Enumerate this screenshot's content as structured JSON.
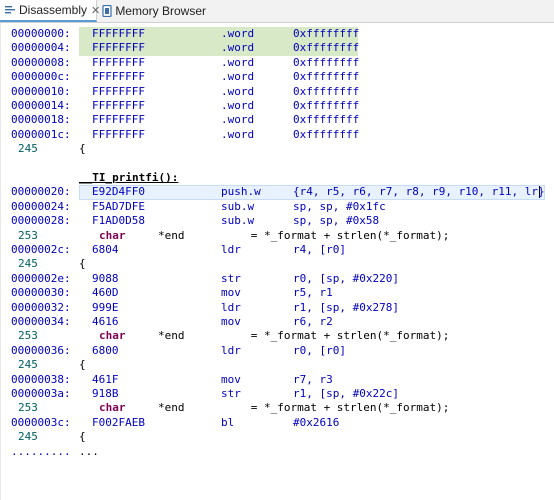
{
  "tabs": [
    {
      "label": "Disassembly",
      "icon": "disassembly-icon"
    },
    {
      "label": "Memory Browser",
      "icon": "memory-browser-icon"
    }
  ],
  "lines": [
    {
      "kind": "asm",
      "addr": "00000000:",
      "op": "FFFFFFFF",
      "mn": ".word",
      "args": "0xffffffff",
      "hl": "green"
    },
    {
      "kind": "asm",
      "addr": "00000004:",
      "op": "FFFFFFFF",
      "mn": ".word",
      "args": "0xffffffff",
      "hl": "green"
    },
    {
      "kind": "asm",
      "addr": "00000008:",
      "op": "FFFFFFFF",
      "mn": ".word",
      "args": "0xffffffff"
    },
    {
      "kind": "asm",
      "addr": "0000000c:",
      "op": "FFFFFFFF",
      "mn": ".word",
      "args": "0xffffffff"
    },
    {
      "kind": "asm",
      "addr": "00000010:",
      "op": "FFFFFFFF",
      "mn": ".word",
      "args": "0xffffffff"
    },
    {
      "kind": "asm",
      "addr": "00000014:",
      "op": "FFFFFFFF",
      "mn": ".word",
      "args": "0xffffffff"
    },
    {
      "kind": "asm",
      "addr": "00000018:",
      "op": "FFFFFFFF",
      "mn": ".word",
      "args": "0xffffffff"
    },
    {
      "kind": "asm",
      "addr": "0000001c:",
      "op": "FFFFFFFF",
      "mn": ".word",
      "args": "0xffffffff"
    },
    {
      "kind": "src",
      "lineno": "245",
      "text": "{"
    },
    {
      "kind": "blank"
    },
    {
      "kind": "func",
      "text": "__TI_printfi():"
    },
    {
      "kind": "asm",
      "addr": "00000020:",
      "op": "E92D4FF0",
      "mn": "push.w",
      "args": "{r4, r5, r6, r7, r8, r9, r10, r11, lr}",
      "hl": "blue"
    },
    {
      "kind": "asm",
      "addr": "00000024:",
      "op": "F5AD7DFE",
      "mn": "sub.w",
      "args": "sp, sp, #0x1fc"
    },
    {
      "kind": "asm",
      "addr": "00000028:",
      "op": "F1AD0D58",
      "mn": "sub.w",
      "args": "sp, sp, #0x58"
    },
    {
      "kind": "src",
      "lineno": "253",
      "kw": "char",
      "text": "*end          = *_format + strlen(*_format);"
    },
    {
      "kind": "asm",
      "addr": "0000002c:",
      "op": "6804",
      "mn": "ldr",
      "args": "r4, [r0]"
    },
    {
      "kind": "src",
      "lineno": "245",
      "text": "{"
    },
    {
      "kind": "asm",
      "addr": "0000002e:",
      "op": "9088",
      "mn": "str",
      "args": "r0, [sp, #0x220]"
    },
    {
      "kind": "asm",
      "addr": "00000030:",
      "op": "460D",
      "mn": "mov",
      "args": "r5, r1"
    },
    {
      "kind": "asm",
      "addr": "00000032:",
      "op": "999E",
      "mn": "ldr",
      "args": "r1, [sp, #0x278]"
    },
    {
      "kind": "asm",
      "addr": "00000034:",
      "op": "4616",
      "mn": "mov",
      "args": "r6, r2"
    },
    {
      "kind": "src",
      "lineno": "253",
      "kw": "char",
      "text": "*end          = *_format + strlen(*_format);"
    },
    {
      "kind": "asm",
      "addr": "00000036:",
      "op": "6800",
      "mn": "ldr",
      "args": "r0, [r0]"
    },
    {
      "kind": "src",
      "lineno": "245",
      "text": "{"
    },
    {
      "kind": "asm",
      "addr": "00000038:",
      "op": "461F",
      "mn": "mov",
      "args": "r7, r3"
    },
    {
      "kind": "asm",
      "addr": "0000003a:",
      "op": "918B",
      "mn": "str",
      "args": "r1, [sp, #0x22c]"
    },
    {
      "kind": "src",
      "lineno": "253",
      "kw": "char",
      "text": "*end          = *_format + strlen(*_format);"
    },
    {
      "kind": "asm",
      "addr": "0000003c:",
      "op": "F002FAEB",
      "mn": "bl",
      "args": "#0x2616"
    },
    {
      "kind": "src",
      "lineno": "245",
      "text": "{"
    },
    {
      "kind": "more",
      "addr": ".........",
      "text": "..."
    }
  ]
}
